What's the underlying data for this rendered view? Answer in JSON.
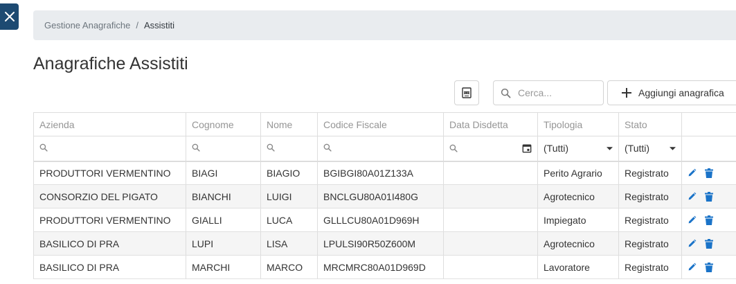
{
  "breadcrumb": {
    "parent": "Gestione Anagrafiche",
    "separator": "/",
    "current": "Assistiti"
  },
  "page": {
    "title": "Anagrafiche Assistiti"
  },
  "toolbar": {
    "export_icon": "xlsx-export-icon",
    "search_placeholder": "Cerca...",
    "add_label": "Aggiungi anagrafica"
  },
  "table": {
    "columns": [
      "Azienda",
      "Cognome",
      "Nome",
      "Codice Fiscale",
      "Data Disdetta",
      "Tipologia",
      "Stato",
      ""
    ],
    "filters": {
      "tipologia": "(Tutti)",
      "stato": "(Tutti)"
    },
    "rows": [
      {
        "azienda": "PRODUTTORI VERMENTINO",
        "cognome": "BIAGI",
        "nome": "BIAGIO",
        "codice_fiscale": "BGIBGI80A01Z133A",
        "data_disdetta": "",
        "tipologia": "Perito Agrario",
        "stato": "Registrato"
      },
      {
        "azienda": "CONSORZIO DEL PIGATO",
        "cognome": "BIANCHI",
        "nome": "LUIGI",
        "codice_fiscale": "BNCLGU80A01I480G",
        "data_disdetta": "",
        "tipologia": "Agrotecnico",
        "stato": "Registrato"
      },
      {
        "azienda": "PRODUTTORI VERMENTINO",
        "cognome": "GIALLI",
        "nome": "LUCA",
        "codice_fiscale": "GLLLCU80A01D969H",
        "data_disdetta": "",
        "tipologia": "Impiegato",
        "stato": "Registrato"
      },
      {
        "azienda": "BASILICO DI PRA",
        "cognome": "LUPI",
        "nome": "LISA",
        "codice_fiscale": "LPULSI90R50Z600M",
        "data_disdetta": "",
        "tipologia": "Agrotecnico",
        "stato": "Registrato"
      },
      {
        "azienda": "BASILICO DI PRA",
        "cognome": "MARCHI",
        "nome": "MARCO",
        "codice_fiscale": "MRCMRC80A01D969D",
        "data_disdetta": "",
        "tipologia": "Lavoratore",
        "stato": "Registrato"
      }
    ]
  },
  "colors": {
    "close_bg": "#1d4a72",
    "breadcrumb_bg": "#e9ecef",
    "action_icon": "#1a73c8"
  }
}
